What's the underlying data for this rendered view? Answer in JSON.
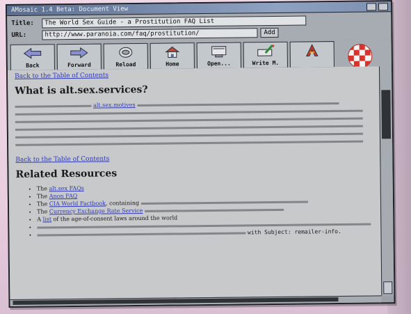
{
  "window": {
    "title": "AMosaic 1.4 Beta: Document View"
  },
  "fields": {
    "title_label": "Title:",
    "title_value": "The World Sex Guide - a Prostitution FAQ List",
    "url_label": "URL:",
    "url_value": "http://www.paranoia.com/faq/prostitution/",
    "url_btn": "Add"
  },
  "toolbar": {
    "items": [
      {
        "label": "Back",
        "icon": "back-arrow-icon"
      },
      {
        "label": "Forward",
        "icon": "forward-arrow-icon"
      },
      {
        "label": "Reload",
        "icon": "reload-icon"
      },
      {
        "label": "Home",
        "icon": "home-icon"
      },
      {
        "label": "Open...",
        "icon": "open-icon"
      },
      {
        "label": "Write M.",
        "icon": "write-mail-icon"
      },
      {
        "label": "",
        "icon": "boing-ball-logo"
      }
    ]
  },
  "content": {
    "back_link_1": "Back to the Table of Contents",
    "section1_heading": "What is alt.sex.services?",
    "section1_link": "alt.sex.motives",
    "back_link_2": "Back to the Table of Contents",
    "section2_heading": "Related Resources",
    "resources": [
      {
        "prefix": "The",
        "link": "alt.sex FAQs",
        "suffix": ""
      },
      {
        "prefix": "The",
        "link": "Anon FAQ",
        "suffix": ""
      },
      {
        "prefix": "The",
        "link": "CIA World Factbook",
        "suffix": ", containing"
      },
      {
        "prefix": "The",
        "link": "Currency Exchange Rate Service",
        "suffix": ""
      },
      {
        "prefix": "A",
        "link": "list",
        "suffix": "of the age-of-consent laws around the world"
      }
    ],
    "misc_line": "with Subject: remailer-info."
  },
  "colors": {
    "link": "#2d38b8",
    "page_bg": "#c8c9cb"
  }
}
